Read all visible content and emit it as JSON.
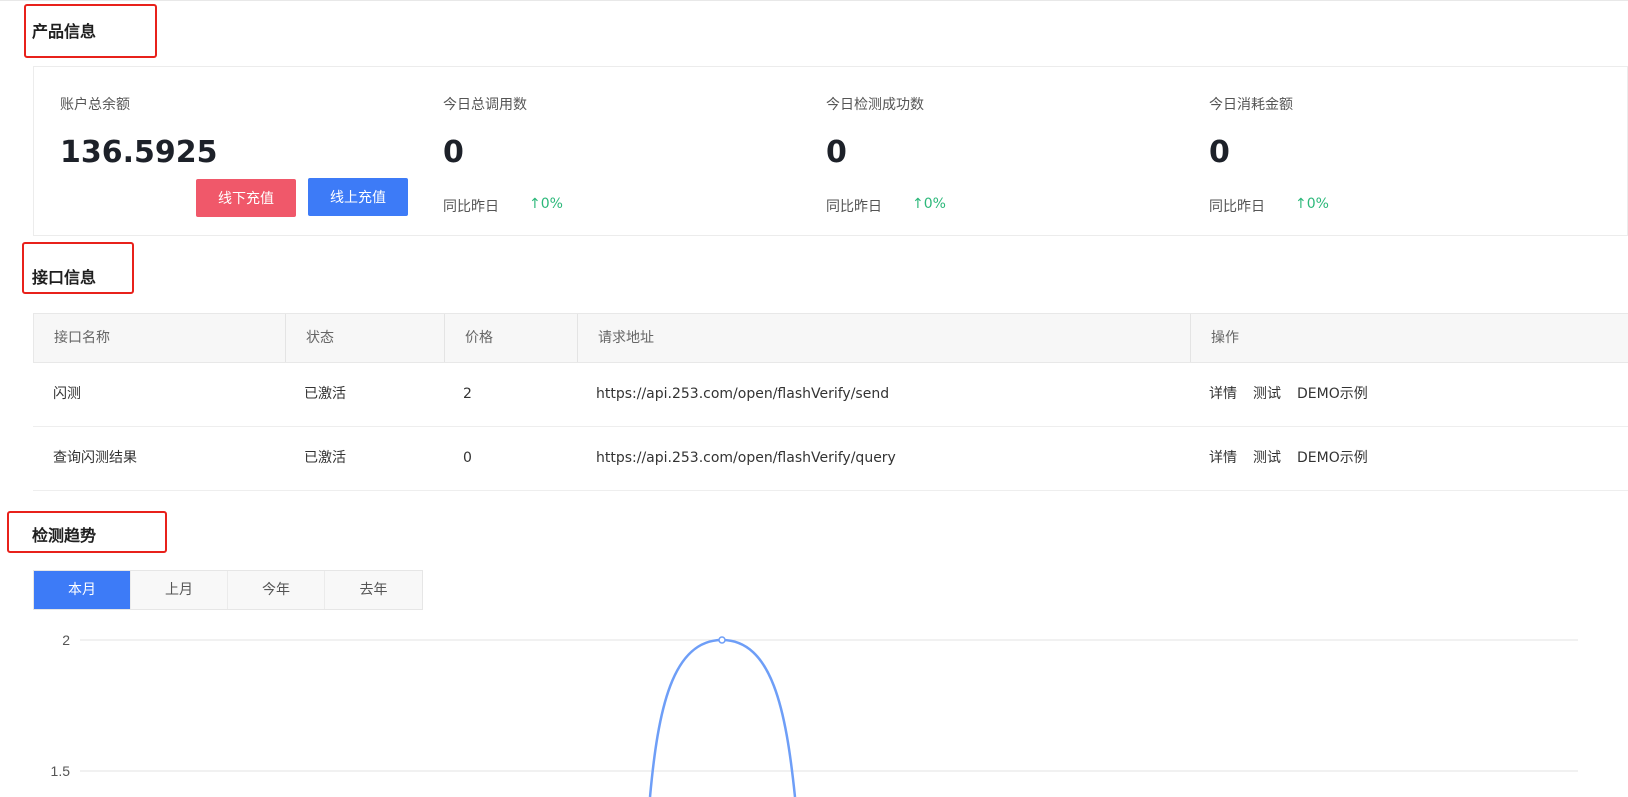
{
  "product_section": {
    "title": "产品信息"
  },
  "stats": [
    {
      "label": "账户总余额",
      "value": "136.5925"
    },
    {
      "label": "今日总调用数",
      "value": "0",
      "compare_label": "同比昨日",
      "change": "0%"
    },
    {
      "label": "今日检测成功数",
      "value": "0",
      "compare_label": "同比昨日",
      "change": "0%"
    },
    {
      "label": "今日消耗金额",
      "value": "0",
      "compare_label": "同比昨日",
      "change": "0%"
    }
  ],
  "buttons": {
    "offline_recharge": "线下充值",
    "online_recharge": "线上充值"
  },
  "api_section": {
    "title": "接口信息",
    "columns": [
      "接口名称",
      "状态",
      "价格",
      "请求地址",
      "操作"
    ],
    "rows": [
      {
        "name": "闪测",
        "status": "已激活",
        "price": "2",
        "url": "https://api.253.com/open/flashVerify/send",
        "actions": [
          "详情",
          "测试",
          "DEMO示例"
        ]
      },
      {
        "name": "查询闪测结果",
        "status": "已激活",
        "price": "0",
        "url": "https://api.253.com/open/flashVerify/query",
        "actions": [
          "详情",
          "测试",
          "DEMO示例"
        ]
      }
    ]
  },
  "trend_section": {
    "title": "检测趋势",
    "tabs": [
      "本月",
      "上月",
      "今年",
      "去年"
    ],
    "active_tab": "本月"
  },
  "chart_data": {
    "type": "line",
    "y_ticks": [
      "2",
      "1.5"
    ],
    "series": [
      {
        "peak_value": 2
      }
    ],
    "colors": {
      "line": "#6e9ef7"
    }
  },
  "colors": {
    "accent": "#3d7bf7",
    "danger": "#f0586a",
    "positive": "#2cb87a",
    "highlight_box": "#e8211b"
  },
  "icons": {
    "change_arrow": "arrow-up-icon"
  }
}
